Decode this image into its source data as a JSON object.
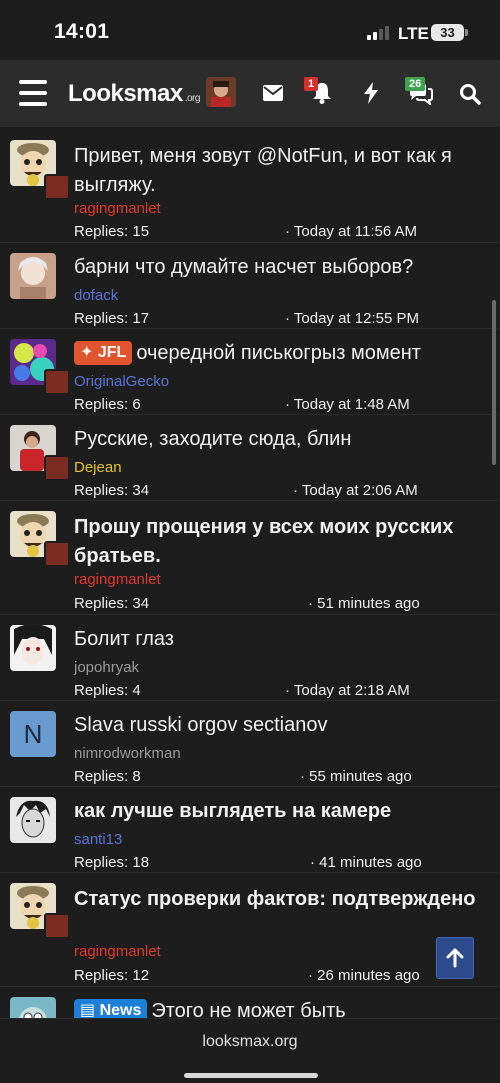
{
  "status_bar": {
    "time": "14:01",
    "network": "LTE",
    "battery": "33"
  },
  "nav": {
    "logo": "Looksmax",
    "logo_suffix": ".org",
    "alerts_badge": "1",
    "conversations_badge": "26",
    "colors": {
      "alerts_badge": "#d0312d",
      "conversations_badge": "#3fa34d"
    }
  },
  "threads": [
    {
      "title": "Привет, меня зовут @NotFun, и вот как я выгляжу.",
      "bold": true,
      "author": "ragingmanlet",
      "author_color": "#e2382e",
      "replies": "Replies: 15",
      "date": "· Today at 11:56 AM"
    },
    {
      "title": "барни что думайте насчет выборов?",
      "bold": false,
      "author": "dofack",
      "author_color": "#5a74d6",
      "replies": "Replies: 17",
      "date": "· Today at 12:55 PM"
    },
    {
      "prefix": "JFL",
      "prefix_color": "#e0552d",
      "title": "очередной писькогрыз момент",
      "bold": false,
      "author": "OriginalGecko",
      "author_color": "#5a74d6",
      "replies": "Replies: 6",
      "date": "· Today at 1:48 AM"
    },
    {
      "title": "Русские, заходите сюда, блин",
      "bold": false,
      "author": "Dejean",
      "author_color": "#e6c229",
      "replies": "Replies: 34",
      "date": "· Today at 2:06 AM"
    },
    {
      "title": "Прошу прощения у всех моих русских братьев.",
      "bold": true,
      "author": "ragingmanlet",
      "author_color": "#e2382e",
      "replies": "Replies: 34",
      "date": "· 51 minutes ago"
    },
    {
      "title": "Болит глаз",
      "bold": false,
      "author": "jopohryak",
      "author_color": "#9a9a9a",
      "replies": "Replies: 4",
      "date": "· Today at 2:18 AM"
    },
    {
      "title": "Slava russki orgov sectianov",
      "bold": false,
      "author": "nimrodworkman",
      "author_color": "#9a9a9a",
      "avatar_letter": "N",
      "replies": "Replies: 8",
      "date": "· 55 minutes ago"
    },
    {
      "title": "как лучше выглядеть на камере",
      "bold": true,
      "author": "santi13",
      "author_color": "#5a74d6",
      "replies": "Replies: 18",
      "date": "· 41 minutes ago"
    },
    {
      "title": "Статус проверки фактов: подтверждено",
      "bold": true,
      "author": "ragingmanlet",
      "author_color": "#e2382e",
      "replies": "Replies: 12",
      "date": "· 26 minutes ago"
    },
    {
      "prefix": "News",
      "prefix_color": "#1d7fd6",
      "title": "Этого не может быть",
      "bold": false,
      "author": "",
      "author_color": "#9a9a9a",
      "replies": "",
      "date": ""
    }
  ],
  "browser": {
    "url": "looksmax.org"
  }
}
